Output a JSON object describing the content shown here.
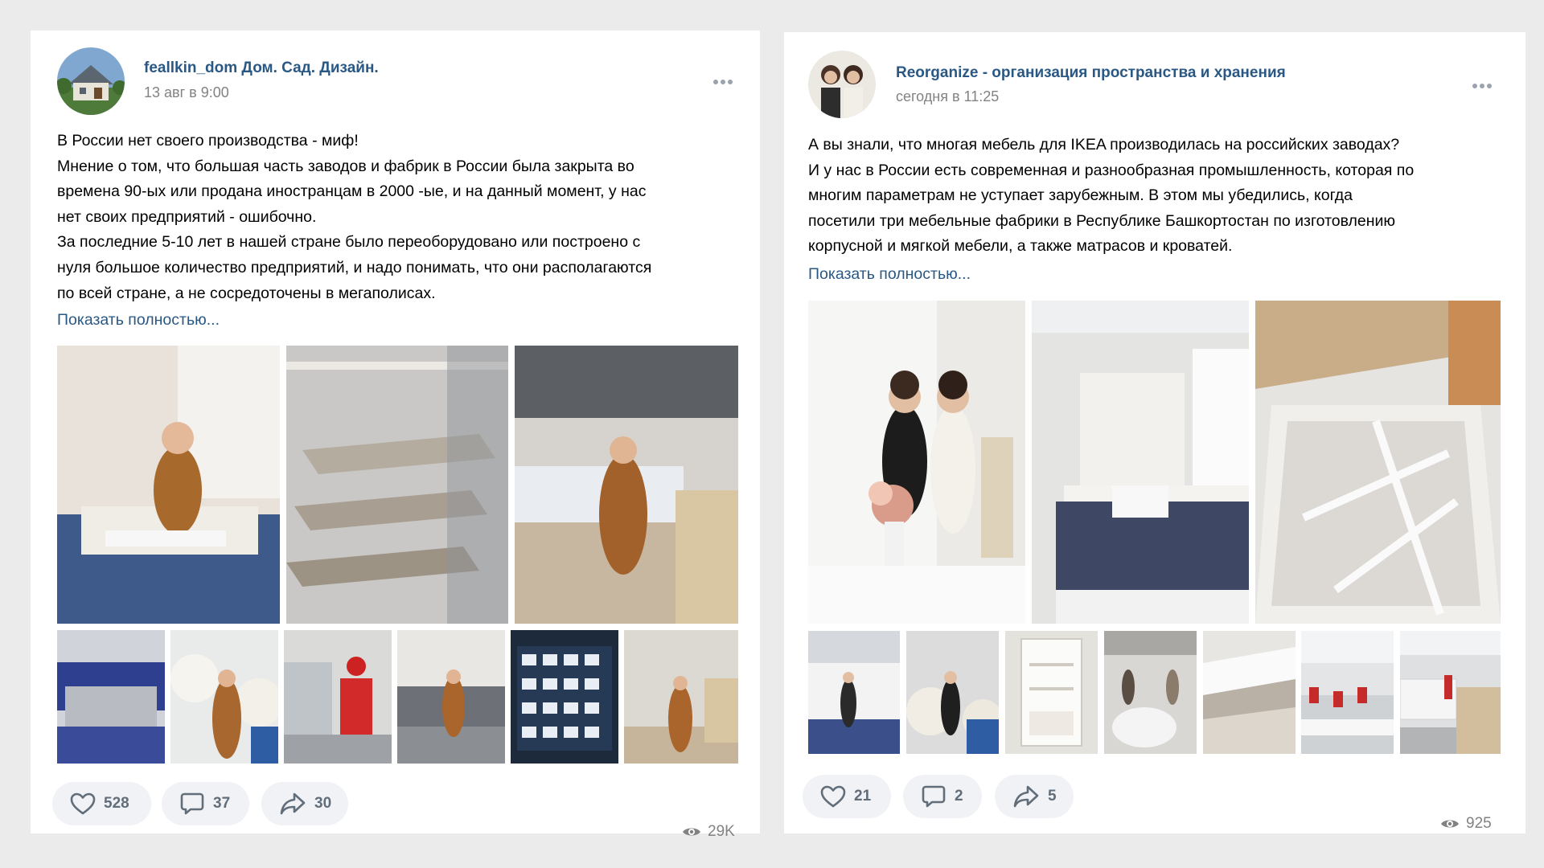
{
  "posts": [
    {
      "author": "feallkin_dom Дом. Сад. Дизайн.",
      "time": "13 авг в 9:00",
      "text_lines": [
        "В России нет своего производства - миф!",
        "Мнение о том, что большая часть заводов и фабрик в России была закрыта во",
        "времена 90-ых или продана иностранцам в 2000 -ые, и на данный момент, у нас",
        "нет своих предприятий - ошибочно.",
        "За последние 5-10 лет в нашей стране было переоборудовано или построено с",
        "нуля большое количество предприятий, и надо понимать, что они располагаются",
        "по всей стране, а не сосредоточены в мегаполисах."
      ],
      "show_more": "Показать полностью...",
      "likes": "528",
      "comments": "37",
      "shares": "30",
      "views": "29K",
      "photo_count": 9
    },
    {
      "author": "Reorganize - организация пространства и хранения",
      "time": "сегодня в 11:25",
      "text_lines": [
        "А вы знали, что многая мебель для IKEA производилась на российских заводах?",
        "И у нас в России есть современная и разнообразная промышленность, которая по",
        "многим параметрам не уступает зарубежным. В этом мы убедились, когда",
        "посетили три мебельные фабрики в Республике Башкортостан по изготовлению",
        "корпусной и мягкой мебели, а также матрасов и кроватей."
      ],
      "show_more": "Показать полностью...",
      "likes": "21",
      "comments": "2",
      "shares": "5",
      "views": "925",
      "photo_count": 10
    }
  ],
  "icons": {
    "like": "heart-icon",
    "comment": "comment-icon",
    "share": "share-icon",
    "views": "eye-icon",
    "more": "more-dots-icon"
  },
  "colors": {
    "link": "#2a5885",
    "secondary_text": "#828282",
    "icon": "#626d7a",
    "pill_bg": "#f0f2f5",
    "page_bg": "#ebebeb"
  }
}
